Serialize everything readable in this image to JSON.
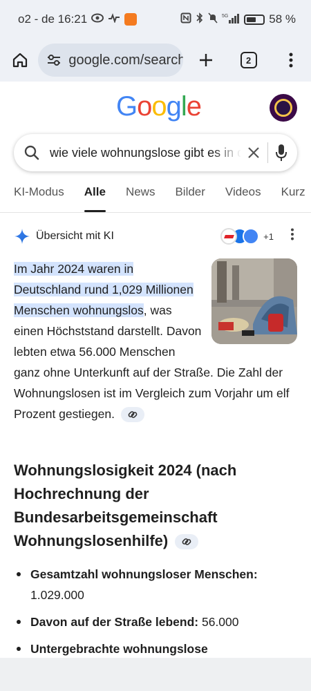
{
  "status_bar": {
    "carrier_time": "o2 - de 16:21",
    "battery": "58 %",
    "network": "5G"
  },
  "browser": {
    "url": "google.com/search",
    "tab_count": "2"
  },
  "google": {
    "logo": [
      "G",
      "o",
      "o",
      "g",
      "l",
      "e"
    ],
    "logo_colors": [
      "#4285F4",
      "#EA4335",
      "#FBBC05",
      "#4285F4",
      "#34A853",
      "#EA4335"
    ],
    "query": "wie viele wohnungslose gibt es in deutschland"
  },
  "tabs": [
    "KI-Modus",
    "Alle",
    "News",
    "Bilder",
    "Videos",
    "Kurz"
  ],
  "ai": {
    "title": "Übersicht mit KI",
    "sources_more": "+1",
    "highlight": "Im Jahr 2024 waren in Deutschland rund 1,029 Millionen Menschen wohnungslos",
    "text": ", was einen Höchststand darstellt. Davon lebten etwa 56.000 Menschen ganz ohne Unterkunft auf der Straße. Die Zahl der Wohnungslosen ist im Vergleich zum Vorjahr um elf Prozent gestiegen."
  },
  "section": {
    "title": "Wohnungslosigkeit 2024 (nach Hochrechnung der Bundesarbeitsgemeinschaft Wohnungslosenhilfe)",
    "bullets": [
      {
        "label": "Gesamtzahl wohnungsloser Menschen:",
        "value": "1.029.000"
      },
      {
        "label": "Davon auf der Straße lebend:",
        "value": "56.000"
      },
      {
        "label": "Untergebrachte wohnungslose",
        "value": ""
      }
    ]
  },
  "colors": {
    "accent_blue": "#1a73e8",
    "highlight": "#d3e3fd",
    "chrome_bg": "#eef1f6"
  }
}
